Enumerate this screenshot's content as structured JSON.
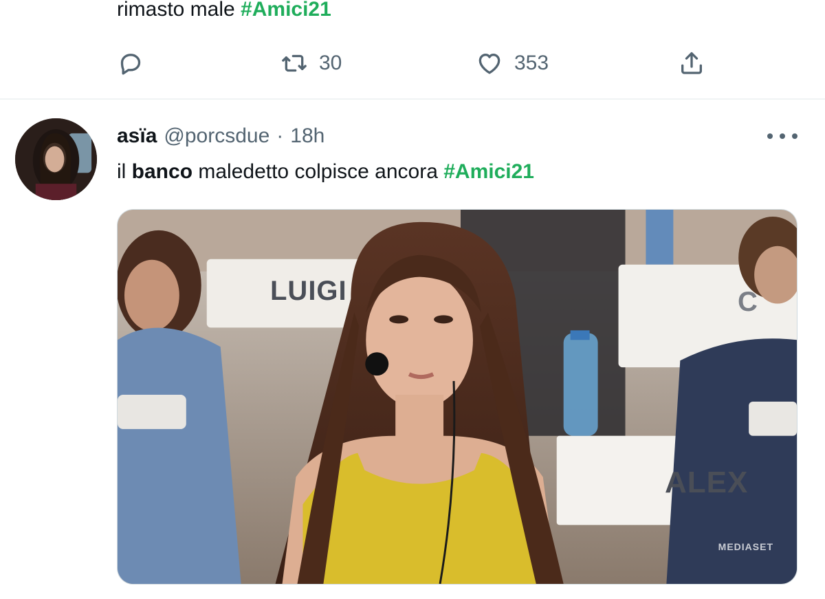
{
  "previous_tweet": {
    "text_plain": "rimasto male ",
    "hashtag": "#Amici21",
    "retweets": "30",
    "likes": "353"
  },
  "tweet": {
    "display_name": "asïa",
    "handle": "@porcsdue",
    "separator": "·",
    "time": "18h",
    "text_part1": "il ",
    "text_bold": "banco",
    "text_part2": " maledetto colpisce ancora ",
    "hashtag": "#Amici21",
    "media": {
      "label_left": "LUIGI",
      "label_right": "ALEX",
      "label_partial": "C",
      "watermark": "MEDIASET"
    }
  },
  "colors": {
    "hashtag": "#1fad5b",
    "text_primary": "#0f1419",
    "text_secondary": "#536471",
    "divider": "#eff3f4"
  },
  "icons": [
    "reply-icon",
    "retweet-icon",
    "like-icon",
    "share-icon",
    "more-icon"
  ]
}
